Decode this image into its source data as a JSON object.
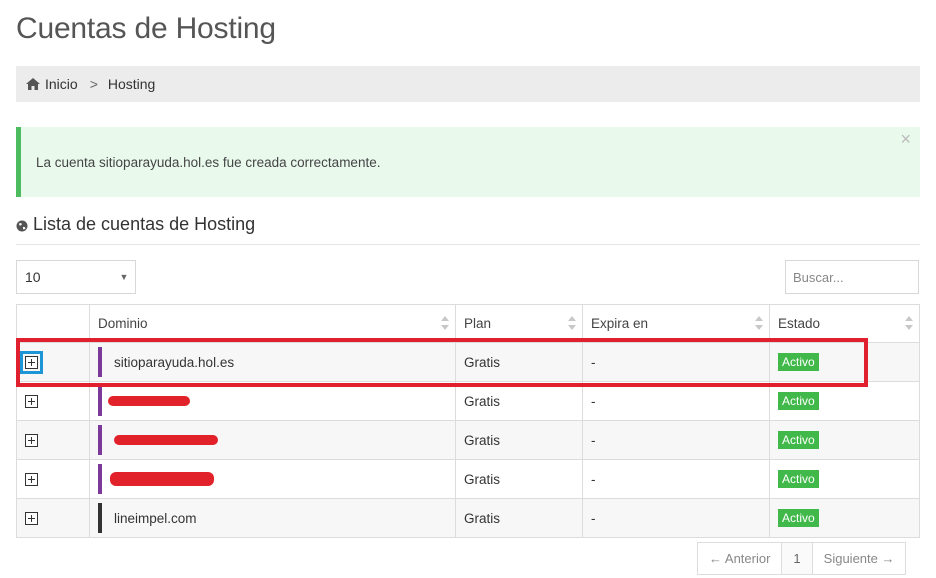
{
  "page": {
    "title": "Cuentas de Hosting"
  },
  "breadcrumb": {
    "home_label": "Inicio",
    "separator": ">",
    "current": "Hosting"
  },
  "alert": {
    "message": "La cuenta sitioparayuda.hol.es fue creada correctamente.",
    "close": "×"
  },
  "section": {
    "title": "Lista de cuentas de Hosting"
  },
  "controls": {
    "length_value": "10",
    "length_arrow": "▼",
    "search_placeholder": "Buscar..."
  },
  "table": {
    "headers": {
      "domain": "Dominio",
      "plan": "Plan",
      "expires": "Expira en",
      "status": "Estado"
    },
    "rows": [
      {
        "domain": "sitioparayuda.hol.es",
        "plan": "Gratis",
        "expires": "-",
        "status": "Activo",
        "bar_color": "#7b3a9a",
        "redacted": false
      },
      {
        "domain": "",
        "plan": "Gratis",
        "expires": "-",
        "status": "Activo",
        "bar_color": "#7b3a9a",
        "redacted": true
      },
      {
        "domain": "",
        "plan": "Gratis",
        "expires": "-",
        "status": "Activo",
        "bar_color": "#7b3a9a",
        "redacted": true
      },
      {
        "domain": "",
        "plan": "Gratis",
        "expires": "-",
        "status": "Activo",
        "bar_color": "#7b3a9a",
        "redacted": true
      },
      {
        "domain": "lineimpel.com",
        "plan": "Gratis",
        "expires": "-",
        "status": "Activo",
        "bar_color": "#333333",
        "redacted": false
      }
    ]
  },
  "pagination": {
    "prev": "← Anterior",
    "current": "1",
    "next": "Siguiente →"
  },
  "colors": {
    "success": "#41b94a",
    "highlight_red": "#e0202e",
    "highlight_blue": "#1e96d6",
    "alert_bg": "#e9faed"
  }
}
